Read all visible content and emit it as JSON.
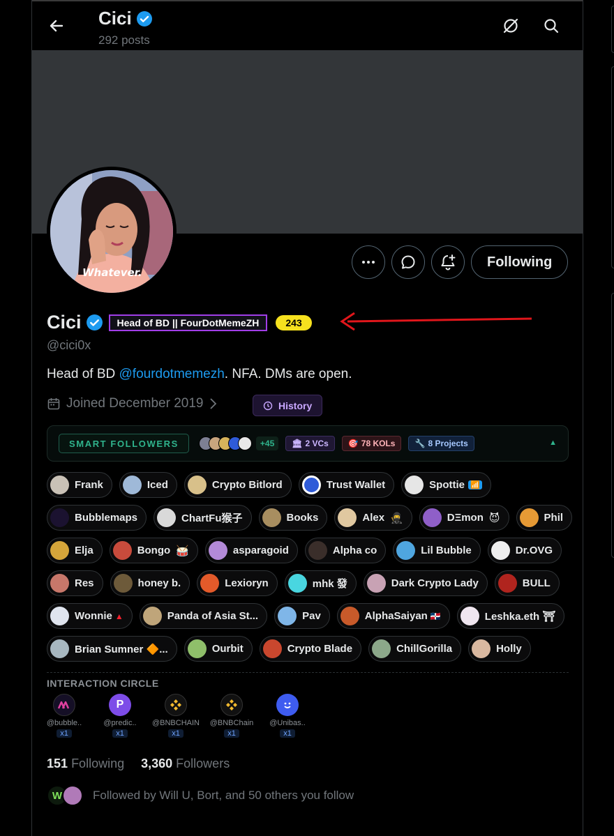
{
  "header": {
    "title": "Cici",
    "post_count": "292 posts",
    "back_icon": "arrow-left-icon",
    "grok_icon": "slash-circle-icon",
    "search_icon": "search-icon"
  },
  "avatar": {
    "caption": "Whatever."
  },
  "actions": {
    "more_icon": "more-horizontal-icon",
    "message_icon": "message-icon",
    "notify_icon": "bell-plus-icon",
    "follow_label": "Following"
  },
  "profile": {
    "name": "Cici",
    "badge_tag": "Head of BD || FourDotMemeZH",
    "score": "243",
    "handle": "@cici0x",
    "bio_prefix": "Head of BD ",
    "bio_link": "@fourdotmemezh",
    "bio_suffix": ". NFA. DMs are open.",
    "joined": "Joined December 2019",
    "history_label": "History"
  },
  "smart_followers": {
    "title": "SMART FOLLOWERS",
    "more": "+45",
    "vcs": "2 VCs",
    "kols": "78 KOLs",
    "projects": "8 Projects"
  },
  "followers": [
    [
      "Frank",
      "Iced",
      "Crypto Bitlord",
      "Trust Wallet",
      "Spottie"
    ],
    [
      "Bubblemaps",
      "ChartFu猴子",
      "Books",
      "Alex",
      "DΞmon",
      "Phil"
    ],
    [
      "Elja",
      "Bongo",
      "asparagoid",
      "Alpha co",
      "Lil Bubble",
      "Dr.OVG"
    ],
    [
      "Res",
      "honey b.",
      "Lexioryn",
      "mhk 發",
      "Dark Crypto Lady",
      "BULL"
    ],
    [
      "Wonnie",
      "Panda of Asia St...",
      "Pav",
      "AlphaSaiyan",
      "Leshka.eth ⛩"
    ],
    [
      "Brian Sumner 🔶...",
      "Ourbit",
      "Crypto Blade",
      "ChillGorilla",
      "Holly"
    ]
  ],
  "interaction_circle": {
    "title": "INTERACTION CIRCLE",
    "items": [
      {
        "handle": "@bubble..",
        "count": "x1"
      },
      {
        "handle": "@predic..",
        "count": "x1"
      },
      {
        "handle": "@BNBCHAIN",
        "count": "x1"
      },
      {
        "handle": "@BNBChain",
        "count": "x1"
      },
      {
        "handle": "@Unibas..",
        "count": "x1"
      }
    ]
  },
  "stats": {
    "following_count": "151",
    "following_label": "Following",
    "followers_count": "3,360",
    "followers_label": "Followers"
  },
  "followed_by": "Followed by Will U, Bort, and 50 others you follow",
  "colors": {
    "accent": "#1d9bf0",
    "badge_border": "#a13ee8",
    "score_bg": "#f6e11e",
    "smart_green": "#2fb38c",
    "arrow_red": "#e0161b"
  }
}
